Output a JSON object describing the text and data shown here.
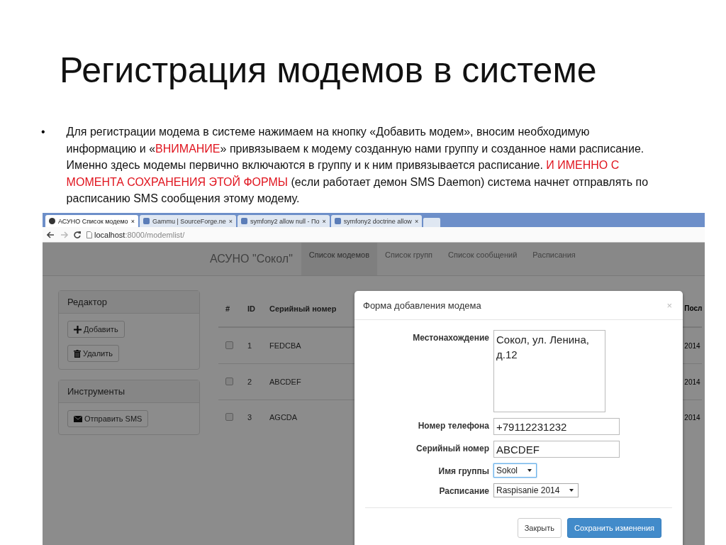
{
  "slide": {
    "title": "Регистрация модемов в системе",
    "bullet": {
      "marker": "•",
      "segments": [
        {
          "text": "Для регистрации модема в системе нажимаем на кнопку «Добавить модем», вносим необходимую информацию и «",
          "highlight": false
        },
        {
          "text": "ВНИМАНИЕ",
          "highlight": true
        },
        {
          "text": "» привязываем к модему созданную нами группу и созданное нами расписание. Именно здесь модемы первично включаются в группу и к ним привязывается расписание. ",
          "highlight": false
        },
        {
          "text": "И ИМЕННО С МОМЕНТА СОХРАНЕНИЯ ЭТОЙ ФОРМЫ",
          "highlight": true
        },
        {
          "text": " (если работает демон SMS Daemon) система начнет отправлять по расписанию SMS сообщения этому модему.",
          "highlight": false
        }
      ]
    }
  },
  "browser": {
    "tabs": [
      {
        "title": "АСУНО Список модемо",
        "close": "×",
        "selected": true
      },
      {
        "title": "Gammu | SourceForge.ne",
        "close": "×",
        "selected": false
      },
      {
        "title": "symfony2 allow null - По",
        "close": "×",
        "selected": false
      },
      {
        "title": "symfony2 doctrine allow",
        "close": "×",
        "selected": false
      }
    ],
    "address": {
      "host": "localhost",
      "path": ":8000/modemlist/"
    }
  },
  "app": {
    "brand": "АСУНО \"Сокол\"",
    "nav": [
      {
        "label": "Список модемов",
        "selected": true
      },
      {
        "label": "Список групп",
        "selected": false
      },
      {
        "label": "Список сообщений",
        "selected": false
      },
      {
        "label": "Расписания",
        "selected": false
      }
    ],
    "panels": [
      {
        "title": "Редактор",
        "buttons": [
          {
            "label": "Добавить",
            "kind": "plus"
          },
          {
            "label": "Удалить",
            "kind": "trash"
          }
        ]
      },
      {
        "title": "Инструменты",
        "buttons": [
          {
            "label": "Отправить SMS",
            "kind": "envelope"
          }
        ]
      }
    ],
    "table": {
      "columns": [
        "#",
        "ID",
        "Серийный номер",
        "Посл"
      ],
      "rows": [
        {
          "checked": false,
          "id": "1",
          "serial": "FEDCBA",
          "column_4": "2014"
        },
        {
          "checked": false,
          "id": "2",
          "serial": "ABCDEF",
          "column_4": "2014"
        },
        {
          "checked": false,
          "id": "3",
          "serial": "AGCDA",
          "column_4": "2014"
        }
      ]
    }
  },
  "modal": {
    "title": "Форма добавления модема",
    "close": "×",
    "fields": [
      {
        "label": "Местонахождение",
        "kind": "textarea",
        "value": "Сокол, ул. Ленина, д.12",
        "focused": false
      },
      {
        "label": "Номер телефона",
        "kind": "input",
        "value": "+79112231232",
        "focused": false
      },
      {
        "label": "Серийный номер",
        "kind": "input",
        "value": "ABCDEF",
        "focused": false
      },
      {
        "label": "Имя группы",
        "kind": "select",
        "value": "Sokol",
        "focused": true
      },
      {
        "label": "Расписание",
        "kind": "select",
        "value": "Raspisanie 2014",
        "focused": false
      }
    ],
    "buttons": [
      {
        "label": "Закрыть",
        "kind": "default"
      },
      {
        "label": "Сохранить изменения",
        "kind": "primary"
      }
    ]
  }
}
